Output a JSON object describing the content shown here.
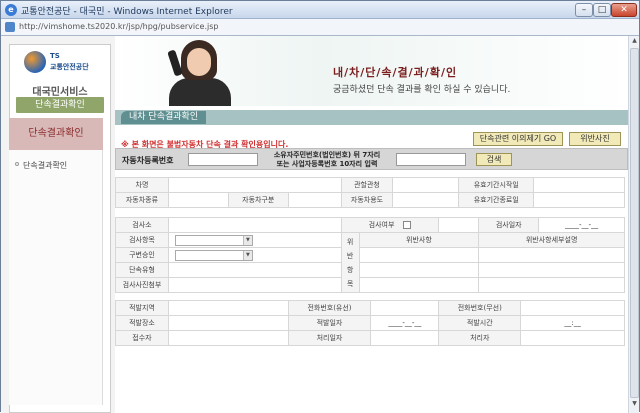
{
  "window": {
    "title": "교통안전공단 - 대국민 - Windows Internet Explorer",
    "url": "http://vimshome.ts2020.kr/jsp/hpg/pubservice.jsp"
  },
  "sidebar": {
    "logo_top": "TS",
    "logo_name": "교통안전공단",
    "service_title": "대국민서비스",
    "menu_button": "단속결과확인",
    "section_header": "단속결과확인",
    "items": [
      "단속결과확인"
    ]
  },
  "hero": {
    "heading": "내/차/단/속/결/과/확/인",
    "subtitle": "궁금하셨던 단속 결과를 확인 하실 수 있습니다."
  },
  "section": {
    "label": "내차 단속결과확인"
  },
  "notice": "※ 본 화면은 불법자동차 단속 결과 확인용입니다.",
  "buttons": {
    "objection": "단속관련 이의제기 GO",
    "photo": "위반사진",
    "search": "검색"
  },
  "search": {
    "regno_label": "자동차등록번호",
    "regno_value": "",
    "owner_label_1": "소유자주민번호(법인번호) 뒤 7자리",
    "owner_label_2": "또는 사업자등록번호 10자리 입력",
    "owner_value": ""
  },
  "vehicle": {
    "name_label": "차명",
    "name_value": "",
    "office_label": "관할관청",
    "office_value": "",
    "valid_start_label": "유효기간시작일",
    "valid_start_value": "",
    "type_label": "자동차종류",
    "type_value": "",
    "class_label": "자동차구분",
    "class_value": "",
    "use_label": "자동차용도",
    "use_value": "",
    "valid_end_label": "유효기간종료일",
    "valid_end_value": ""
  },
  "inspection": {
    "station_label": "검사소",
    "station_value": "",
    "inspected_label": "검사여부",
    "date_label": "검사일자",
    "date_value": "____-__-__",
    "item_label": "검사항목",
    "approval_label": "구변승인",
    "type_label": "단속유형",
    "photo_label": "검사사진첨부",
    "violation_side": [
      "위",
      "반",
      "항",
      "목"
    ],
    "violation_col": "위반사항",
    "violation_detail_col": "위반사항세부설명"
  },
  "place": {
    "region_label": "적발지역",
    "region_value": "",
    "phone_wire_label": "전화번호(유선)",
    "phone_wire_value": "",
    "phone_mobile_label": "전화번호(무선)",
    "phone_mobile_value": "",
    "spot_label": "적발장소",
    "spot_value": "",
    "date_label": "적발일자",
    "date_value": "____-__-__",
    "time_label": "적발시간",
    "time_value": "__:__",
    "receiver_label": "접수자",
    "receiver_value": "",
    "process_date_label": "처리일자",
    "process_date_value": "",
    "processor_label": "처리자",
    "processor_value": ""
  }
}
